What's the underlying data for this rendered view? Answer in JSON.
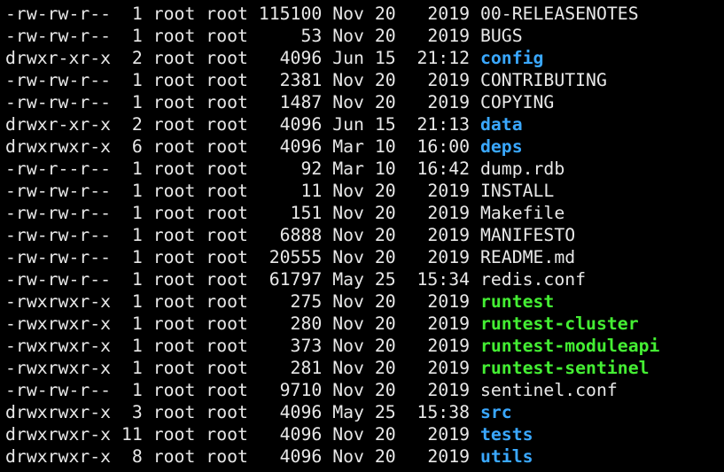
{
  "terminal": {
    "listing": [
      {
        "perms": "-rw-rw-r--",
        "links": "1",
        "owner": "root",
        "group": "root",
        "size": "115100",
        "month": "Nov",
        "day": "20",
        "time": "2019",
        "name": "00-RELEASENOTES",
        "type": "file"
      },
      {
        "perms": "-rw-rw-r--",
        "links": "1",
        "owner": "root",
        "group": "root",
        "size": "53",
        "month": "Nov",
        "day": "20",
        "time": "2019",
        "name": "BUGS",
        "type": "file"
      },
      {
        "perms": "drwxr-xr-x",
        "links": "2",
        "owner": "root",
        "group": "root",
        "size": "4096",
        "month": "Jun",
        "day": "15",
        "time": "21:12",
        "name": "config",
        "type": "dir"
      },
      {
        "perms": "-rw-rw-r--",
        "links": "1",
        "owner": "root",
        "group": "root",
        "size": "2381",
        "month": "Nov",
        "day": "20",
        "time": "2019",
        "name": "CONTRIBUTING",
        "type": "file"
      },
      {
        "perms": "-rw-rw-r--",
        "links": "1",
        "owner": "root",
        "group": "root",
        "size": "1487",
        "month": "Nov",
        "day": "20",
        "time": "2019",
        "name": "COPYING",
        "type": "file"
      },
      {
        "perms": "drwxr-xr-x",
        "links": "2",
        "owner": "root",
        "group": "root",
        "size": "4096",
        "month": "Jun",
        "day": "15",
        "time": "21:13",
        "name": "data",
        "type": "dir"
      },
      {
        "perms": "drwxrwxr-x",
        "links": "6",
        "owner": "root",
        "group": "root",
        "size": "4096",
        "month": "Mar",
        "day": "10",
        "time": "16:00",
        "name": "deps",
        "type": "dir"
      },
      {
        "perms": "-rw-r--r--",
        "links": "1",
        "owner": "root",
        "group": "root",
        "size": "92",
        "month": "Mar",
        "day": "10",
        "time": "16:42",
        "name": "dump.rdb",
        "type": "file"
      },
      {
        "perms": "-rw-rw-r--",
        "links": "1",
        "owner": "root",
        "group": "root",
        "size": "11",
        "month": "Nov",
        "day": "20",
        "time": "2019",
        "name": "INSTALL",
        "type": "file"
      },
      {
        "perms": "-rw-rw-r--",
        "links": "1",
        "owner": "root",
        "group": "root",
        "size": "151",
        "month": "Nov",
        "day": "20",
        "time": "2019",
        "name": "Makefile",
        "type": "file"
      },
      {
        "perms": "-rw-rw-r--",
        "links": "1",
        "owner": "root",
        "group": "root",
        "size": "6888",
        "month": "Nov",
        "day": "20",
        "time": "2019",
        "name": "MANIFESTO",
        "type": "file"
      },
      {
        "perms": "-rw-rw-r--",
        "links": "1",
        "owner": "root",
        "group": "root",
        "size": "20555",
        "month": "Nov",
        "day": "20",
        "time": "2019",
        "name": "README.md",
        "type": "file"
      },
      {
        "perms": "-rw-rw-r--",
        "links": "1",
        "owner": "root",
        "group": "root",
        "size": "61797",
        "month": "May",
        "day": "25",
        "time": "15:34",
        "name": "redis.conf",
        "type": "file"
      },
      {
        "perms": "-rwxrwxr-x",
        "links": "1",
        "owner": "root",
        "group": "root",
        "size": "275",
        "month": "Nov",
        "day": "20",
        "time": "2019",
        "name": "runtest",
        "type": "exec"
      },
      {
        "perms": "-rwxrwxr-x",
        "links": "1",
        "owner": "root",
        "group": "root",
        "size": "280",
        "month": "Nov",
        "day": "20",
        "time": "2019",
        "name": "runtest-cluster",
        "type": "exec"
      },
      {
        "perms": "-rwxrwxr-x",
        "links": "1",
        "owner": "root",
        "group": "root",
        "size": "373",
        "month": "Nov",
        "day": "20",
        "time": "2019",
        "name": "runtest-moduleapi",
        "type": "exec"
      },
      {
        "perms": "-rwxrwxr-x",
        "links": "1",
        "owner": "root",
        "group": "root",
        "size": "281",
        "month": "Nov",
        "day": "20",
        "time": "2019",
        "name": "runtest-sentinel",
        "type": "exec"
      },
      {
        "perms": "-rw-rw-r--",
        "links": "1",
        "owner": "root",
        "group": "root",
        "size": "9710",
        "month": "Nov",
        "day": "20",
        "time": "2019",
        "name": "sentinel.conf",
        "type": "file"
      },
      {
        "perms": "drwxrwxr-x",
        "links": "3",
        "owner": "root",
        "group": "root",
        "size": "4096",
        "month": "May",
        "day": "25",
        "time": "15:38",
        "name": "src",
        "type": "dir"
      },
      {
        "perms": "drwxrwxr-x",
        "links": "11",
        "owner": "root",
        "group": "root",
        "size": "4096",
        "month": "Nov",
        "day": "20",
        "time": "2019",
        "name": "tests",
        "type": "dir"
      },
      {
        "perms": "drwxrwxr-x",
        "links": "8",
        "owner": "root",
        "group": "root",
        "size": "4096",
        "month": "Nov",
        "day": "20",
        "time": "2019",
        "name": "utils",
        "type": "dir"
      }
    ],
    "colors": {
      "background": "#000000",
      "text": "#e8e8e8",
      "directory": "#3aa8ff",
      "executable": "#44ee33"
    }
  }
}
